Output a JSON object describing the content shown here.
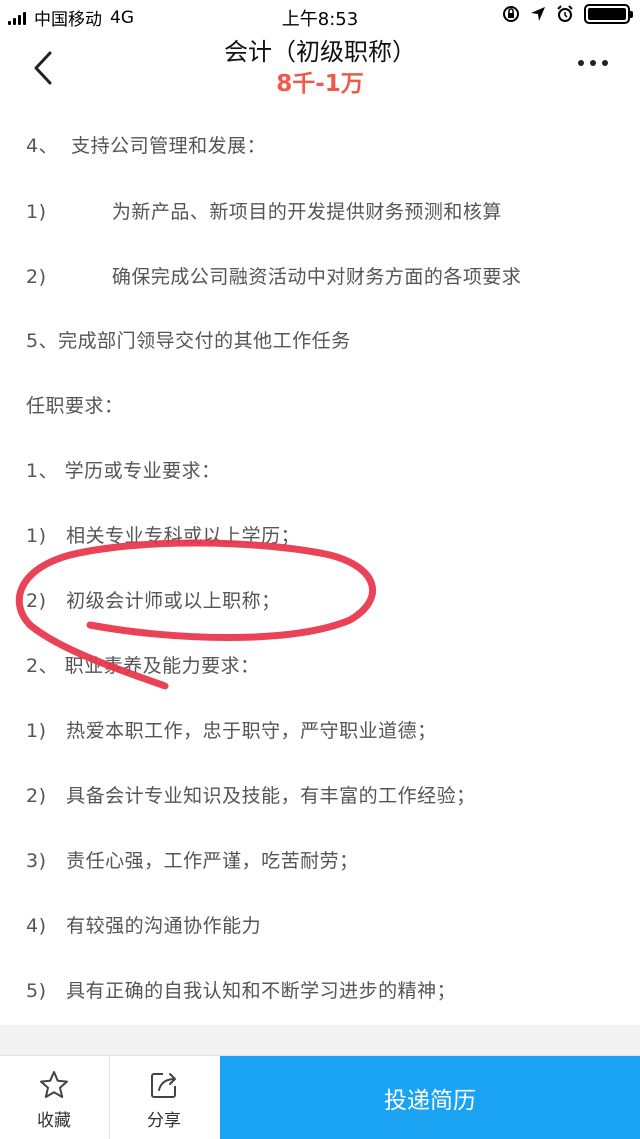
{
  "status_bar": {
    "carrier": "中国移动",
    "network": "4G",
    "time": "上午8:53"
  },
  "header": {
    "title": "会计（初级职称）",
    "salary": "8千-1万"
  },
  "content_lines": [
    "4、  支持公司管理和发展：",
    "1)          为新产品、新项目的开发提供财务预测和核算",
    "2)          确保完成公司融资活动中对财务方面的各项要求",
    "5、完成部门领导交付的其他工作任务",
    "任职要求：",
    "1、 学历或专业要求：",
    "1)   相关专业专科或以上学历；",
    "2)   初级会计师或以上职称；",
    "2、 职业素养及能力要求：",
    "1)   热爱本职工作，忠于职守，严守职业道德；",
    "2)   具备会计专业知识及技能，有丰富的工作经验；",
    "3)   责任心强，工作严谨，吃苦耐劳；",
    "4)   有较强的沟通协作能力",
    "5)   具有正确的自我认知和不断学习进步的精神；"
  ],
  "bottom_bar": {
    "favorite_label": "收藏",
    "share_label": "分享",
    "apply_label": "投递简历"
  },
  "colors": {
    "salary": "#f05a4a",
    "apply_button": "#1aa2f3",
    "annotation": "#e8334a"
  }
}
